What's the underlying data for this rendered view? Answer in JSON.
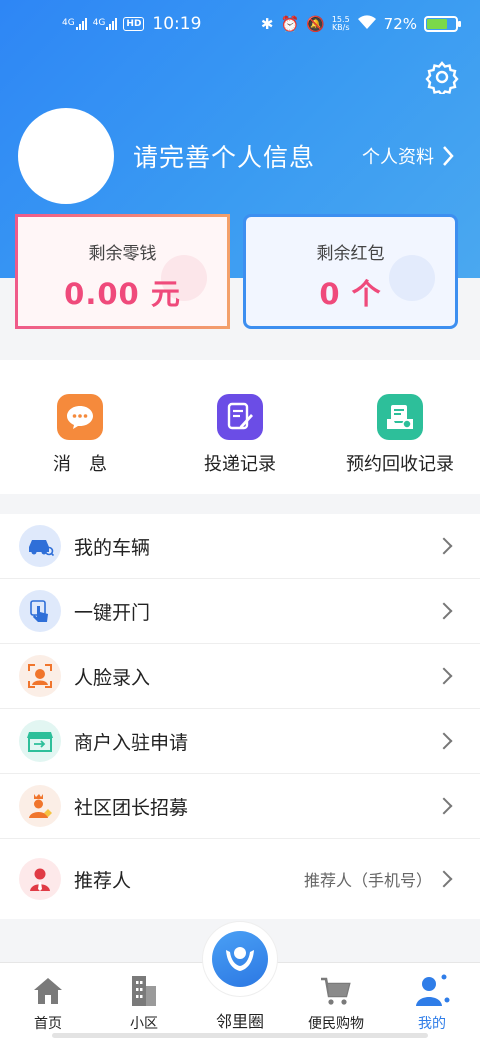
{
  "status_bar": {
    "network_1": "4G",
    "network_2": "4G",
    "hd": "HD",
    "time": "10:19",
    "speed_value": "15.5",
    "speed_unit": "KB/s",
    "battery_text": "72%",
    "battery_level": 0.72
  },
  "profile": {
    "name_prompt": "请完善个人信息",
    "profile_link": "个人资料"
  },
  "wallet": {
    "balance_label": "剩余零钱",
    "balance_value": "0.00 元",
    "redpacket_label": "剩余红包",
    "redpacket_value": "0 个"
  },
  "quick_actions": [
    {
      "label": "消　息",
      "icon": "message-icon",
      "color": "#f58a3c"
    },
    {
      "label": "投递记录",
      "icon": "document-edit-icon",
      "color": "#6b4de6"
    },
    {
      "label": "预约回收记录",
      "icon": "recycle-record-icon",
      "color": "#2dbf9a"
    }
  ],
  "menu": [
    {
      "label": "我的车辆",
      "icon": "car-icon",
      "hint": ""
    },
    {
      "label": "一键开门",
      "icon": "tap-door-icon",
      "hint": ""
    },
    {
      "label": "人脸录入",
      "icon": "face-scan-icon",
      "hint": ""
    },
    {
      "label": "商户入驻申请",
      "icon": "store-icon",
      "hint": ""
    },
    {
      "label": "社区团长招募",
      "icon": "leader-icon",
      "hint": ""
    },
    {
      "label": "推荐人",
      "icon": "referrer-icon",
      "hint": "推荐人（手机号）"
    }
  ],
  "tabbar": {
    "home": "首页",
    "community": "小区",
    "neighbors": "邻里圈",
    "shopping": "便民购物",
    "mine": "我的"
  },
  "colors": {
    "header_blue": "#2e86f5",
    "accent_pink": "#ef4a7b",
    "active_tab": "#2f7de8"
  }
}
